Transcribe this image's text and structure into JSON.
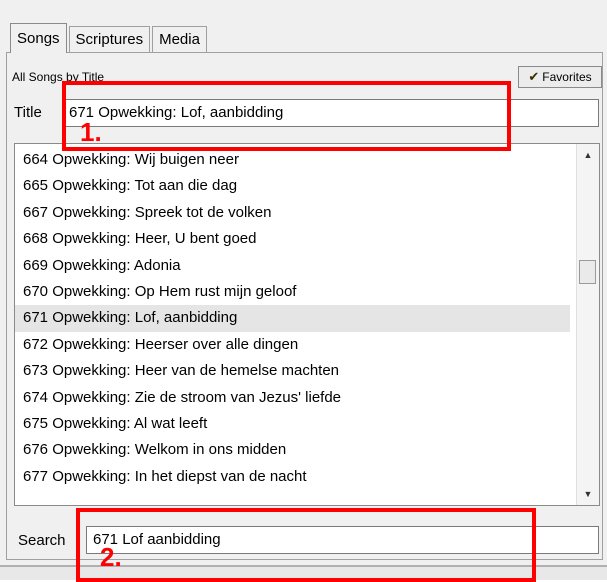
{
  "tabs": [
    {
      "label": "Songs",
      "active": true
    },
    {
      "label": "Scriptures",
      "active": false
    },
    {
      "label": "Media",
      "active": false
    }
  ],
  "header": {
    "collection_label": "All Songs by Title",
    "favorites_button": "Favorites",
    "favorites_icon": "check-icon"
  },
  "title_field": {
    "label": "Title",
    "value": "671 Opwekking: Lof, aanbidding"
  },
  "song_list": {
    "items": [
      "664 Opwekking: Wij buigen neer",
      "665 Opwekking: Tot aan die dag",
      "667 Opwekking: Spreek tot de volken",
      "668 Opwekking: Heer, U bent goed",
      "669 Opwekking: Adonia",
      "670 Opwekking: Op Hem rust mijn geloof",
      "671 Opwekking: Lof, aanbidding",
      "672 Opwekking: Heerser over alle dingen",
      "673 Opwekking: Heer van de hemelse machten",
      "674 Opwekking: Zie de stroom van Jezus' liefde",
      "675 Opwekking: Al wat leeft",
      "676 Opwekking: Welkom in ons midden",
      "677 Opwekking: In het diepst van de nacht"
    ],
    "selected_index": 6
  },
  "search_field": {
    "label": "Search",
    "value": "671 Lof aanbidding"
  },
  "annotations": [
    {
      "number": "1."
    },
    {
      "number": "2."
    }
  ],
  "colors": {
    "annotation": "#ff0000",
    "selected_row": "#e5e5e5",
    "panel": "#f0f0f0"
  }
}
